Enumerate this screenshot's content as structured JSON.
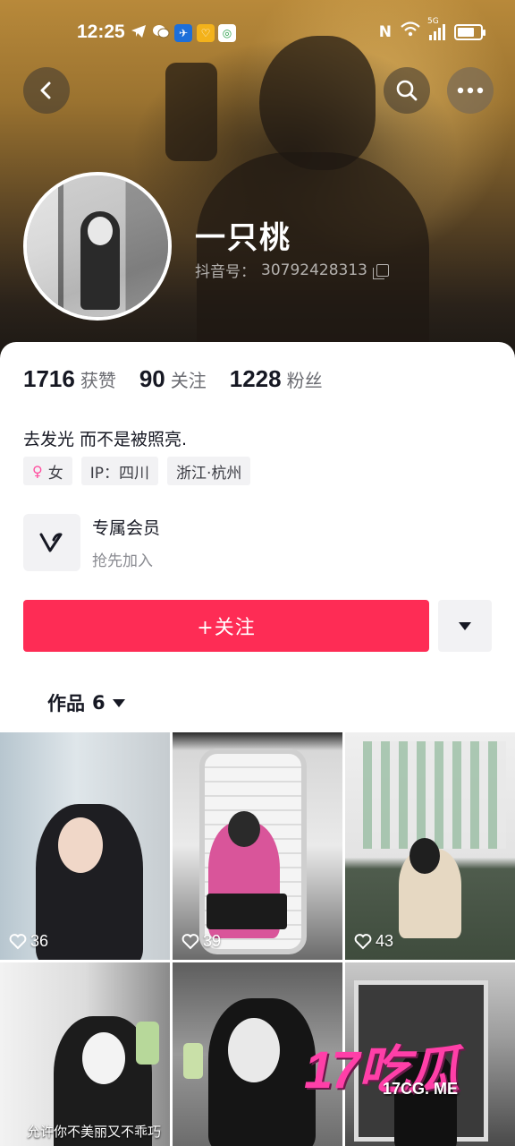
{
  "status_bar": {
    "time": "12:25",
    "network": "5G"
  },
  "profile": {
    "nickname": "一只桃",
    "douyin_id_label": "抖音号：",
    "douyin_id": "30792428313"
  },
  "stats": [
    {
      "value": "1716",
      "label": "获赞"
    },
    {
      "value": "90",
      "label": "关注"
    },
    {
      "value": "1228",
      "label": "粉丝"
    }
  ],
  "bio": "去发光 而不是被照亮.",
  "tags": {
    "gender": "女",
    "ip": "IP：四川",
    "location": "浙江·杭州"
  },
  "member": {
    "title": "专属会员",
    "subtitle": "抢先加入"
  },
  "actions": {
    "follow_label": "+关注"
  },
  "works_tab": {
    "label": "作品",
    "count": "6"
  },
  "grid": [
    {
      "likes": "36"
    },
    {
      "likes": "39"
    },
    {
      "likes": "43"
    },
    {
      "likes": "",
      "caption": "允许你不美丽又不乖巧"
    },
    {
      "likes": ""
    },
    {
      "likes": ""
    }
  ],
  "watermark": {
    "big": "17吃瓜",
    "small": "17CG. ME"
  },
  "colors": {
    "accent": "#fe2c55",
    "watermark": "#ff3fa8"
  }
}
